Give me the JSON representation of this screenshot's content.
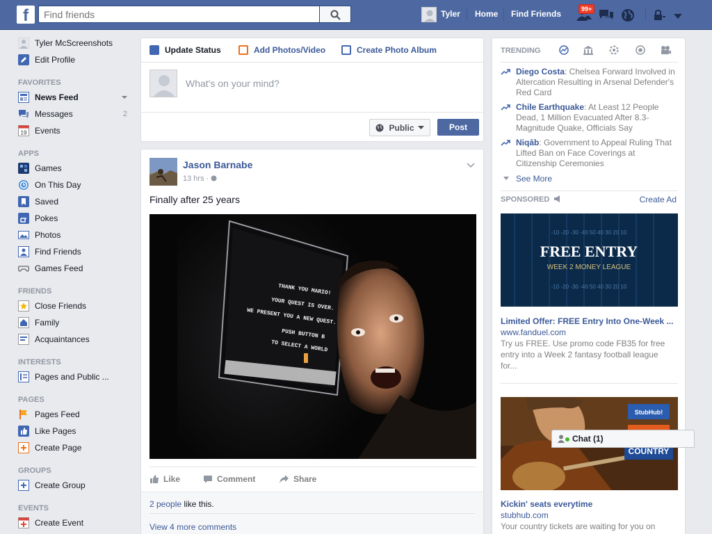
{
  "topbar": {
    "logo": "f",
    "search_placeholder": "Find friends",
    "user_name": "Tyler",
    "home": "Home",
    "find_friends": "Find Friends",
    "notification_badge": "99+"
  },
  "leftnav": {
    "profile_name": "Tyler McScreenshots",
    "edit_profile": "Edit Profile",
    "sections": {
      "favorites": "FAVORITES",
      "apps": "APPS",
      "friends": "FRIENDS",
      "interests": "INTERESTS",
      "pages": "PAGES",
      "groups": "GROUPS",
      "events": "EVENTS"
    },
    "favorites": {
      "news_feed": "News Feed",
      "messages": "Messages",
      "messages_count": "2",
      "events": "Events",
      "events_icon_num": "19"
    },
    "apps": {
      "games": "Games",
      "on_this_day": "On This Day",
      "saved": "Saved",
      "pokes": "Pokes",
      "photos": "Photos",
      "find_friends": "Find Friends",
      "games_feed": "Games Feed"
    },
    "friends": {
      "close_friends": "Close Friends",
      "family": "Family",
      "acquaintances": "Acquaintances"
    },
    "interests": {
      "pages_and_public": "Pages and Public ..."
    },
    "pages": {
      "pages_feed": "Pages Feed",
      "like_pages": "Like Pages",
      "create_page": "Create Page"
    },
    "groups": {
      "create_group": "Create Group"
    },
    "events": {
      "create_event": "Create Event"
    }
  },
  "composer": {
    "tab_update_status": "Update Status",
    "tab_add_photos": "Add Photos/Video",
    "tab_create_album": "Create Photo Album",
    "placeholder": "What's on your mind?",
    "privacy": "Public",
    "post_button": "Post"
  },
  "post": {
    "author": "Jason Barnabe",
    "time": "13 hrs · ",
    "text": "Finally after 25 years",
    "like": "Like",
    "comment": "Comment",
    "share": "Share",
    "likes_link": "2 people",
    "likes_suffix": " like this.",
    "view_comments": "View 4 more comments",
    "screen_text": [
      "THANK YOU MARIO!",
      "YOUR QUEST IS OVER.",
      "WE PRESENT YOU A NEW QUEST.",
      "PUSH BUTTON B",
      "TO SELECT A WORLD"
    ]
  },
  "trending": {
    "header": "TRENDING",
    "items": [
      {
        "topic": "Diego Costa",
        "desc": ": Chelsea Forward Involved in Altercation Resulting in Arsenal Defender's Red Card"
      },
      {
        "topic": "Chile Earthquake",
        "desc": ": At Least 12 People Dead, 1 Million Evacuated After 8.3-Magnitude Quake, Officials Say"
      },
      {
        "topic": "Niqāb",
        "desc": ": Government to Appeal Ruling That Lifted Ban on Face Coverings at Citizenship Ceremonies"
      }
    ],
    "see_more": "See More"
  },
  "sponsored": {
    "header": "SPONSORED",
    "create_ad": "Create Ad",
    "ads": [
      {
        "image_headline": "FREE ENTRY",
        "image_sub": "WEEK 2 MONEY LEAGUE",
        "yard_numbers": "-10 -20 -30 -40 50 40 30 20 10",
        "title": "Limited Offer: FREE Entry Into One-Week ...",
        "url": "www.fanduel.com",
        "body": "Try us FREE. Use promo code FB35 for free entry into a Week 2 fantasy football league for..."
      },
      {
        "image_brand": "StubHub!",
        "image_word": "COUNTRY",
        "title": "Kickin' seats everytime",
        "url": "stubhub.com",
        "body": "Your country tickets are waiting for you on"
      }
    ]
  },
  "chat": {
    "label": "Chat (1)"
  },
  "colors": {
    "topbar": "#4e69a2",
    "link": "#3b5998",
    "badge": "#f03d25",
    "page_bg": "#e9eaed"
  }
}
